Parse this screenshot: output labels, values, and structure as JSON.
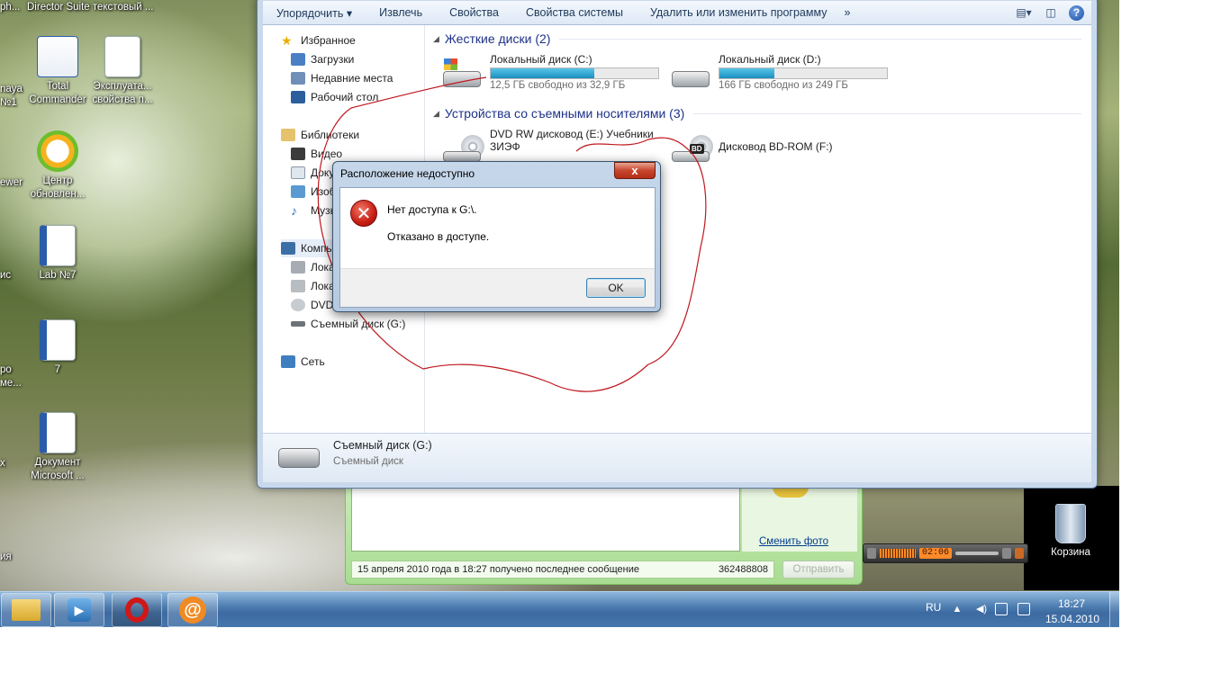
{
  "desktop": {
    "fragments": [
      "ph...",
      "Director Suite текстовый ...",
      "naya",
      "№1",
      "ewer",
      "ис",
      "ро",
      "ме...",
      "x",
      "ия"
    ],
    "icons": [
      {
        "label": "Total Commander"
      },
      {
        "label": "Эксплуата... свойства п..."
      },
      {
        "label": "Центр обновлен..."
      },
      {
        "label": "Lab №7"
      },
      {
        "label": "7"
      },
      {
        "label": "Документ Microsoft ..."
      }
    ],
    "recycle_bin": "Корзина"
  },
  "explorer": {
    "toolbar": {
      "organize": "Упорядочить",
      "eject": "Извлечь",
      "properties": "Свойства",
      "system_properties": "Свойства системы",
      "uninstall": "Удалить или изменить программу",
      "more": "»"
    },
    "nav": {
      "favorites": "Избранное",
      "downloads": "Загрузки",
      "recent": "Недавние места",
      "desktop": "Рабочий стол",
      "libraries": "Библиотеки",
      "video": "Видео",
      "documents": "Доку",
      "images": "Изоб",
      "music": "Музы",
      "computer": "Компь",
      "local_c": "Лока",
      "local_d": "Лока",
      "dvd": "DVD",
      "removable_g": "Съемный диск (G:)",
      "network": "Сеть"
    },
    "groups": {
      "hard_disks": "Жесткие диски (2)",
      "removable": "Устройства со съемными носителями (3)"
    },
    "drives": {
      "c": {
        "name": "Локальный диск (C:)",
        "free": "12,5 ГБ свободно из 32,9 ГБ",
        "used_fraction": 0.62
      },
      "d": {
        "name": "Локальный диск (D:)",
        "free": "166 ГБ свободно из 249 ГБ",
        "used_fraction": 0.33
      },
      "e": {
        "name_line1": "DVD RW дисковод (E:) Учебники",
        "name_line2": "ЗИЭФ"
      },
      "f": {
        "name": "Дисковод BD-ROM (F:)",
        "badge": "BD"
      }
    },
    "details": {
      "name": "Съемный диск (G:)",
      "type": "Съемный диск"
    }
  },
  "dialog": {
    "title": "Расположение недоступно",
    "message1": "Нет доступа к G:\\.",
    "message2": "Отказано в доступе.",
    "ok": "OK",
    "close": "x"
  },
  "chat": {
    "change_photo": "Сменить фото",
    "status": "15 апреля 2010 года в 18:27 получено последнее сообщение",
    "number": "362488808",
    "send": "Отправить"
  },
  "media": {
    "time": "02:06"
  },
  "taskbar": {
    "lang": "RU",
    "time": "18:27",
    "date": "15.04.2010"
  },
  "colors": {
    "annotation_stroke": "#c0181f",
    "taskbar": "#4676ab",
    "explorer_frame": "#c9d9ec"
  }
}
